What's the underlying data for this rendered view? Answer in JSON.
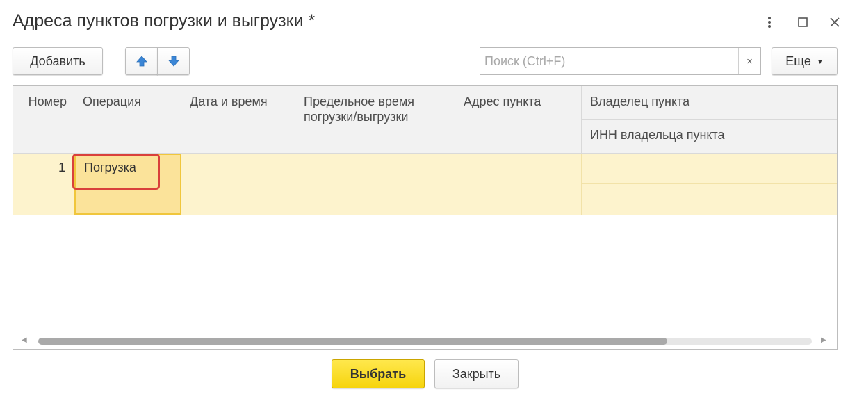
{
  "window": {
    "title": "Адреса пунктов погрузки и выгрузки *",
    "more_icon": "vertical-dots-icon",
    "maximize_icon": "maximize-icon",
    "close_icon": "close-icon"
  },
  "toolbar": {
    "add_label": "Добавить",
    "move_up_icon": "arrow-up-icon",
    "move_down_icon": "arrow-down-icon",
    "search_placeholder": "Поиск (Ctrl+F)",
    "search_value": "",
    "search_clear_label": "×",
    "more_label": "Еще",
    "more_caret": "▼"
  },
  "table": {
    "columns": [
      {
        "key": "number",
        "label": "Номер"
      },
      {
        "key": "operation",
        "label": "Операция"
      },
      {
        "key": "datetime",
        "label": "Дата и время"
      },
      {
        "key": "deadline",
        "label": "Предельное время погрузки/выгрузки"
      },
      {
        "key": "address",
        "label": "Адрес пункта"
      },
      {
        "key": "owner",
        "label": "Владелец пункта"
      },
      {
        "key": "owner_inn",
        "label": "ИНН владельца пункта"
      }
    ],
    "rows": [
      {
        "number": "1",
        "operation": "Погрузка",
        "datetime": "",
        "deadline": "",
        "address": "",
        "owner": "",
        "owner_inn": ""
      }
    ],
    "scroll_left_arrow": "◀",
    "scroll_right_arrow": "▶",
    "horizontal_scroll_fraction": 0.81
  },
  "footer": {
    "select_label": "Выбрать",
    "close_label": "Закрыть"
  },
  "colors": {
    "accent_yellow": "#f6d40d",
    "selected_row": "#fdf3cd",
    "active_cell": "#fbe39a",
    "highlight_frame": "#d9403b",
    "arrow_blue": "#3b86d6"
  }
}
